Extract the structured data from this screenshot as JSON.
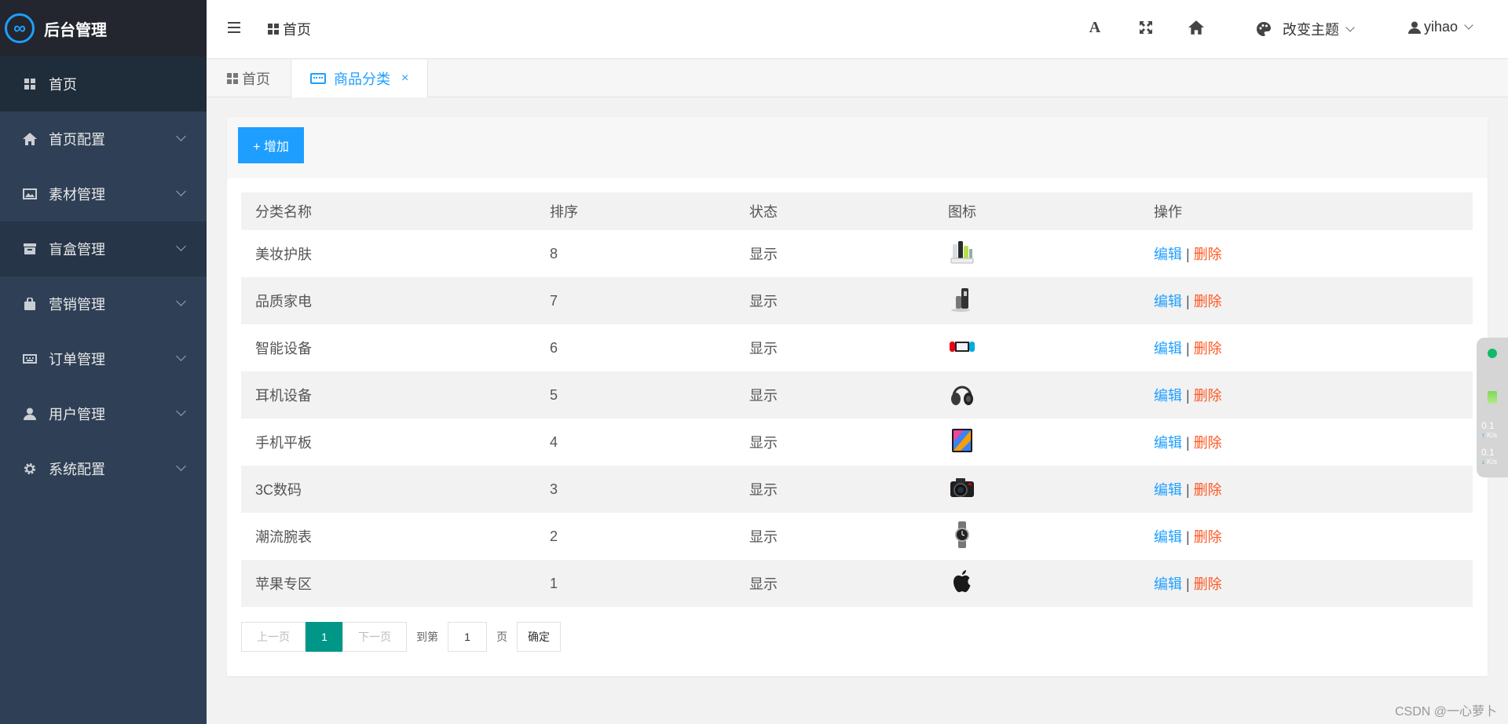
{
  "app": {
    "title": "后台管理",
    "logo_glyph": "∞",
    "accent": "#1e9fff"
  },
  "sidebar": {
    "items": [
      {
        "label": "首页",
        "icon": "grid-icon",
        "active": true
      },
      {
        "label": "首页配置",
        "icon": "home-icon"
      },
      {
        "label": "素材管理",
        "icon": "image-icon"
      },
      {
        "label": "盲盒管理",
        "icon": "box-icon"
      },
      {
        "label": "营销管理",
        "icon": "bag-icon"
      },
      {
        "label": "订单管理",
        "icon": "keyboard-icon"
      },
      {
        "label": "用户管理",
        "icon": "user-icon"
      },
      {
        "label": "系统配置",
        "icon": "gear-icon"
      }
    ]
  },
  "header": {
    "breadcrumb": "首页",
    "font_glyph": "A",
    "theme_label": "改变主题",
    "username": "yihao"
  },
  "tabs": [
    {
      "label": "首页"
    },
    {
      "label": "商品分类",
      "close": "×"
    }
  ],
  "toolbar": {
    "add_label": "+ 增加"
  },
  "table": {
    "columns": [
      "分类名称",
      "排序",
      "状态",
      "图标",
      "操作"
    ],
    "rows": [
      {
        "name": "美妆护肤",
        "sort": "8",
        "status": "显示",
        "icon": "cosmetics-icon"
      },
      {
        "name": "品质家电",
        "sort": "7",
        "status": "显示",
        "icon": "appliance-icon"
      },
      {
        "name": "智能设备",
        "sort": "6",
        "status": "显示",
        "icon": "game-console-icon"
      },
      {
        "name": "耳机设备",
        "sort": "5",
        "status": "显示",
        "icon": "headphones-icon"
      },
      {
        "name": "手机平板",
        "sort": "4",
        "status": "显示",
        "icon": "tablet-icon"
      },
      {
        "name": "3C数码",
        "sort": "3",
        "status": "显示",
        "icon": "camera-icon"
      },
      {
        "name": "潮流腕表",
        "sort": "2",
        "status": "显示",
        "icon": "watch-icon"
      },
      {
        "name": "苹果专区",
        "sort": "1",
        "status": "显示",
        "icon": "apple-icon"
      }
    ],
    "edit_label": "编辑",
    "separator": "|",
    "delete_label": "删除"
  },
  "pager": {
    "prev": "上一页",
    "current": "1",
    "next": "下一页",
    "goto_label": "到第",
    "goto_value": "1",
    "page_unit": "页",
    "confirm": "确定"
  },
  "monitor": {
    "up_value": "0.1",
    "up_unit": "K/s",
    "down_value": "0.1",
    "down_unit": "K/s"
  },
  "watermark": "CSDN @一心萝卜"
}
